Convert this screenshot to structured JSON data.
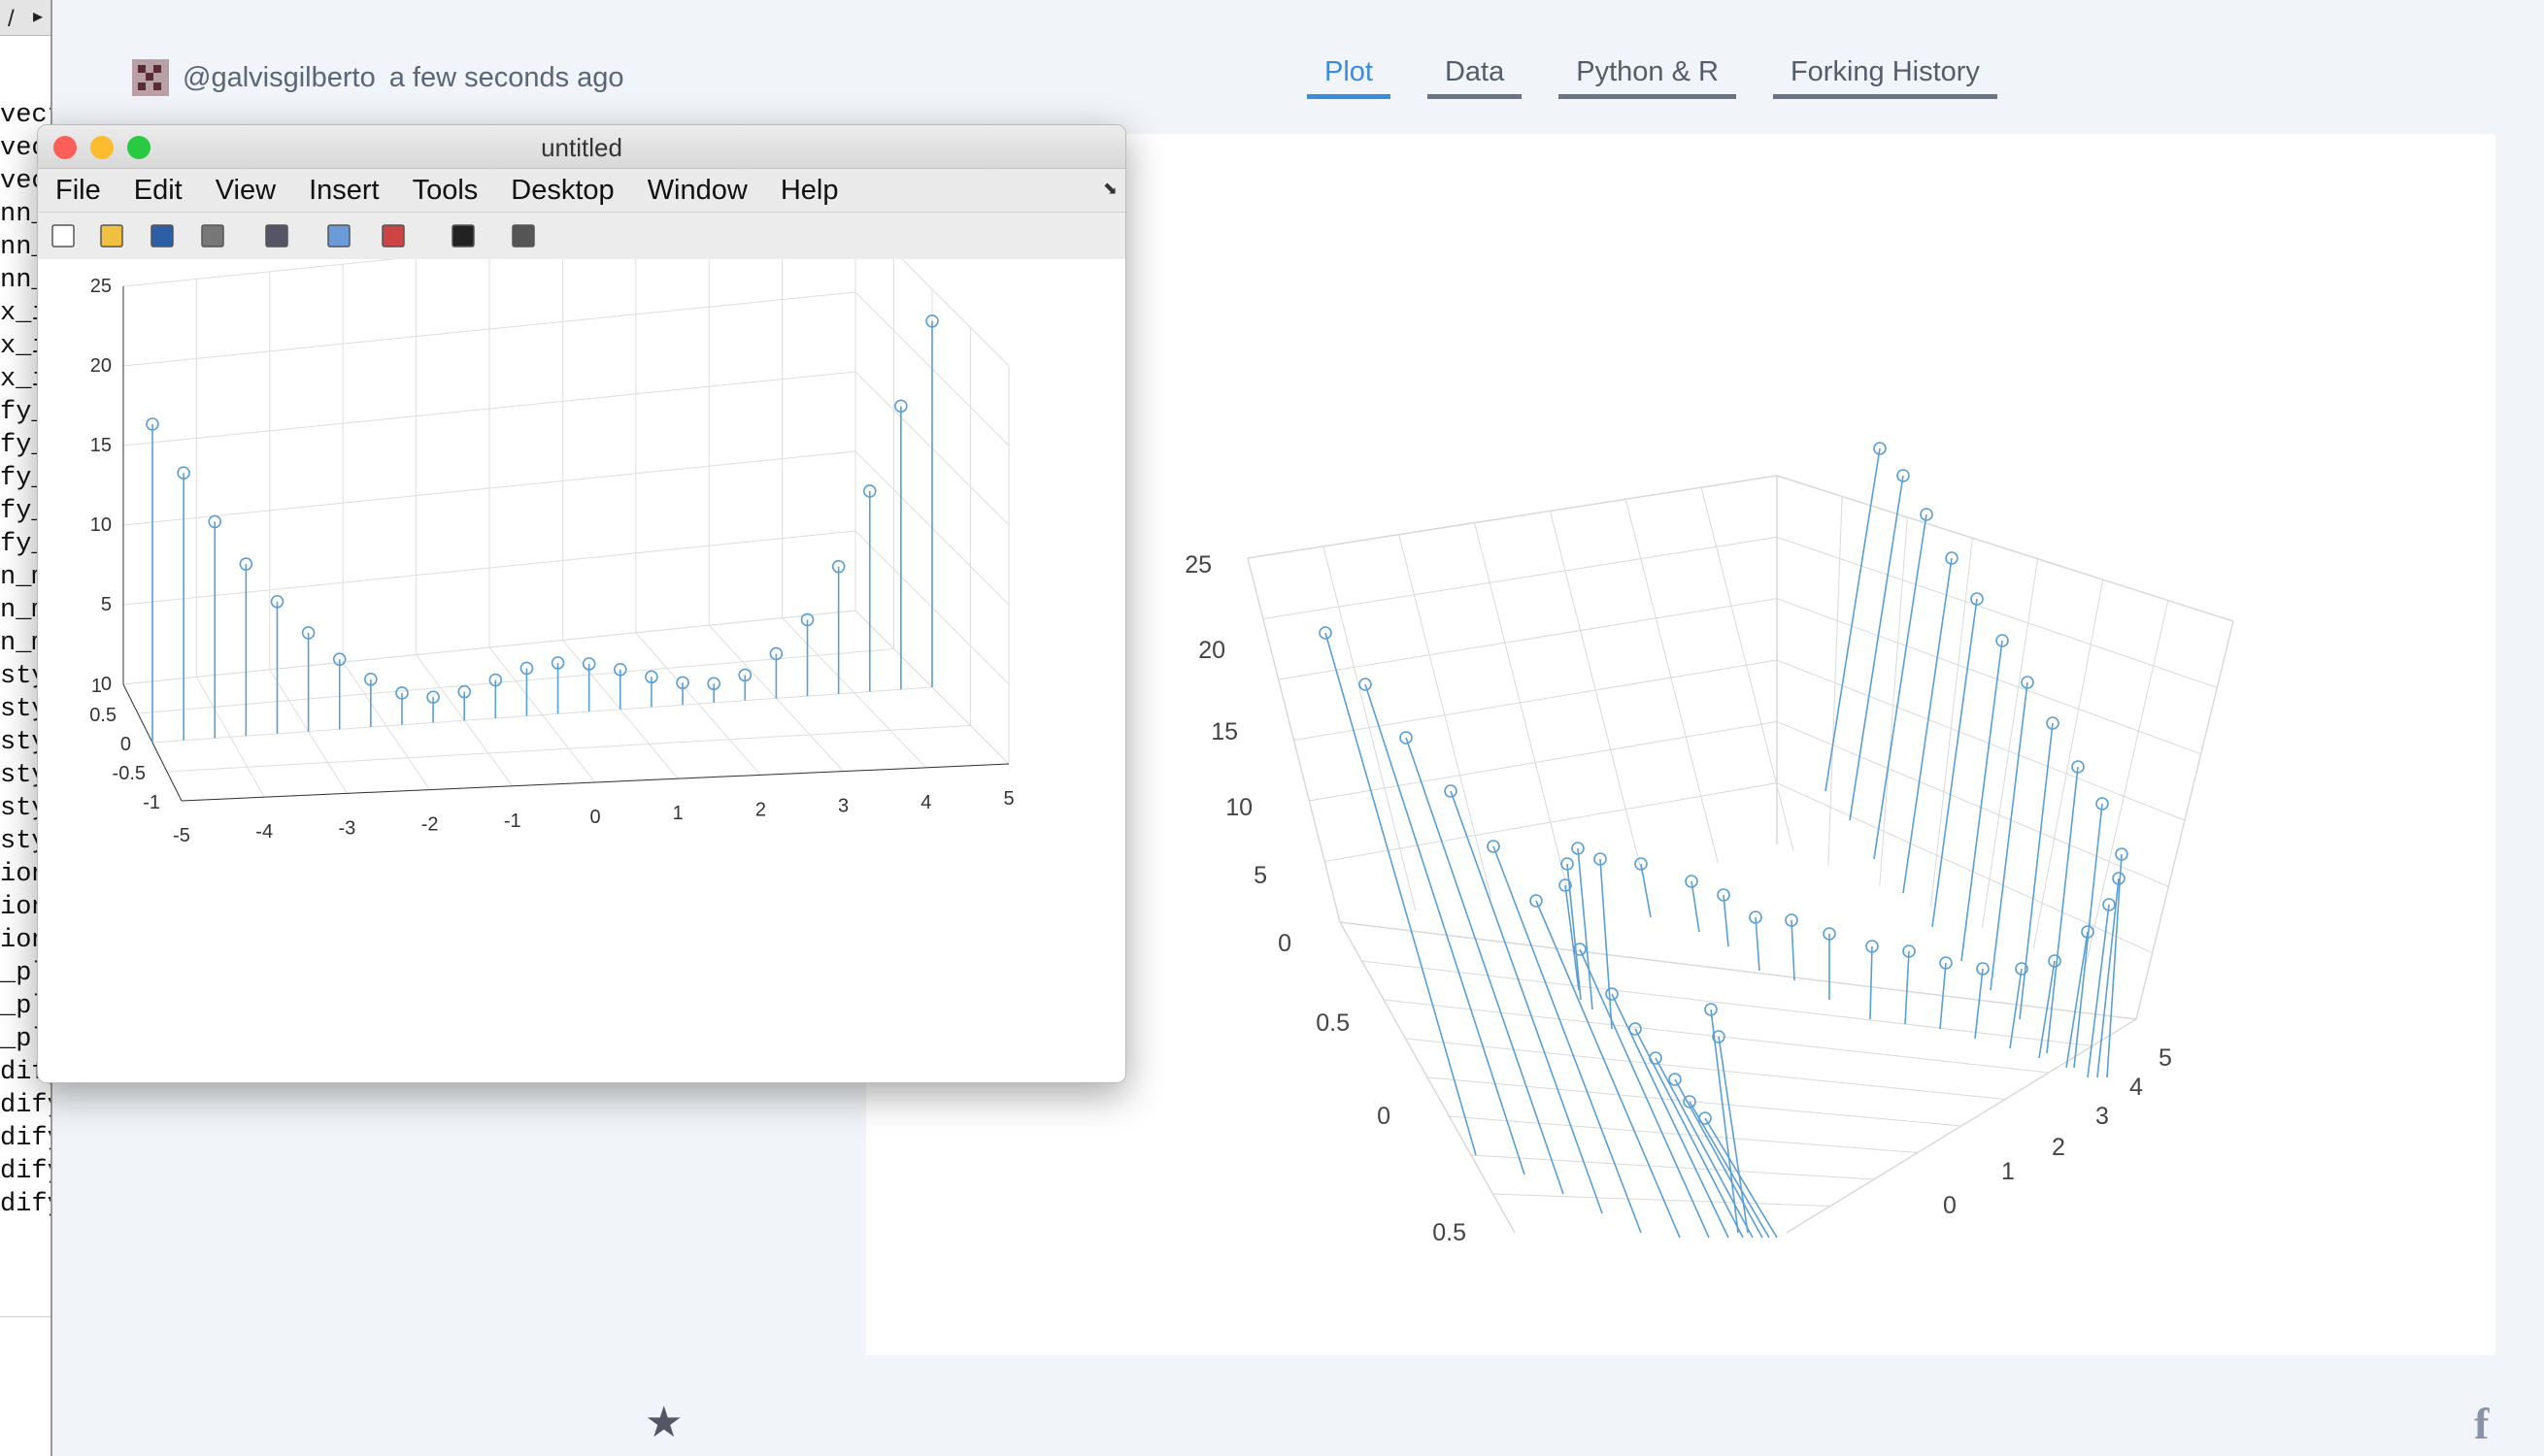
{
  "editor": {
    "lines": [
      "vect",
      "vect",
      "vect",
      "nn_",
      "nn_",
      "nn_",
      "x_i",
      "x_i",
      "x_i",
      "fy_",
      "fy_",
      "fy_",
      "fy_",
      "fy_",
      "n_m",
      "n_m",
      "n_m",
      "styl",
      "styl",
      "styl",
      "styl",
      "styl",
      "styl",
      "ion",
      "ion",
      "ion",
      "_plo",
      "_plo",
      "_plo",
      "dify_",
      "dify_",
      "dify_",
      "dify_",
      "dify_"
    ]
  },
  "header": {
    "username": "@galvisgilberto",
    "timestamp": "a few seconds ago",
    "tabs": [
      {
        "label": "Plot",
        "active": true
      },
      {
        "label": "Data",
        "active": false
      },
      {
        "label": "Python & R",
        "active": false
      },
      {
        "label": "Forking History",
        "active": false
      }
    ]
  },
  "matlab_window": {
    "title": "untitled",
    "menus": [
      "File",
      "Edit",
      "View",
      "Insert",
      "Tools",
      "Desktop",
      "Window",
      "Help"
    ],
    "toolbar_icons": [
      "new-figure-icon",
      "open-icon",
      "save-icon",
      "print-icon",
      "link-icon",
      "colorbar-icon",
      "legend-icon",
      "pointer-icon",
      "property-editor-icon"
    ]
  },
  "colors": {
    "accent": "#3a8cdf",
    "stem": "#5a9fd4"
  },
  "chart_data": [
    {
      "type": "stem3",
      "renderer": "MATLAB figure",
      "x": [
        -5,
        -4.6,
        -4.2,
        -3.8,
        -3.4,
        -3,
        -2.6,
        -2.2,
        -1.8,
        -1.4,
        -1,
        -0.6,
        -0.2,
        0.2,
        0.6,
        1,
        1.4,
        1.8,
        2.2,
        2.6,
        3,
        3.4,
        3.8,
        4.2,
        4.6,
        5
      ],
      "y": [
        0,
        0,
        0,
        0,
        0,
        0,
        0,
        0,
        0,
        0,
        0,
        0,
        0,
        0,
        0,
        0,
        0,
        0,
        0,
        0,
        0,
        0,
        0,
        0,
        0,
        0
      ],
      "z": [
        20,
        16.8,
        13.6,
        10.8,
        8.3,
        6.2,
        4.4,
        3.0,
        2.0,
        1.6,
        1.8,
        2.4,
        3.0,
        3.2,
        3.0,
        2.5,
        1.9,
        1.4,
        1.2,
        1.6,
        2.8,
        4.8,
        8.0,
        12.6,
        17.8,
        23
      ],
      "xlim": [
        -5,
        5
      ],
      "ylim": [
        -1,
        1
      ],
      "zlim": [
        0,
        25
      ],
      "xticks": [
        "-5",
        "-4",
        "-3",
        "-2",
        "-1",
        "0",
        "1",
        "2",
        "3",
        "4",
        "5"
      ],
      "yticks": [
        "1",
        "0.5",
        "0",
        "-0.5",
        "-1"
      ],
      "zticks": [
        "25",
        "20",
        "15",
        "10",
        "5",
        "0"
      ],
      "grid": true
    },
    {
      "type": "stem3",
      "renderer": "Plotly 3D",
      "zticks": [
        "25",
        "20",
        "15",
        "10",
        "5",
        "0"
      ],
      "yticks": [
        "0.5",
        "0",
        "0.5"
      ],
      "xticks": [
        "5",
        "4",
        "3",
        "2",
        "1",
        "0"
      ],
      "grid": true
    }
  ]
}
